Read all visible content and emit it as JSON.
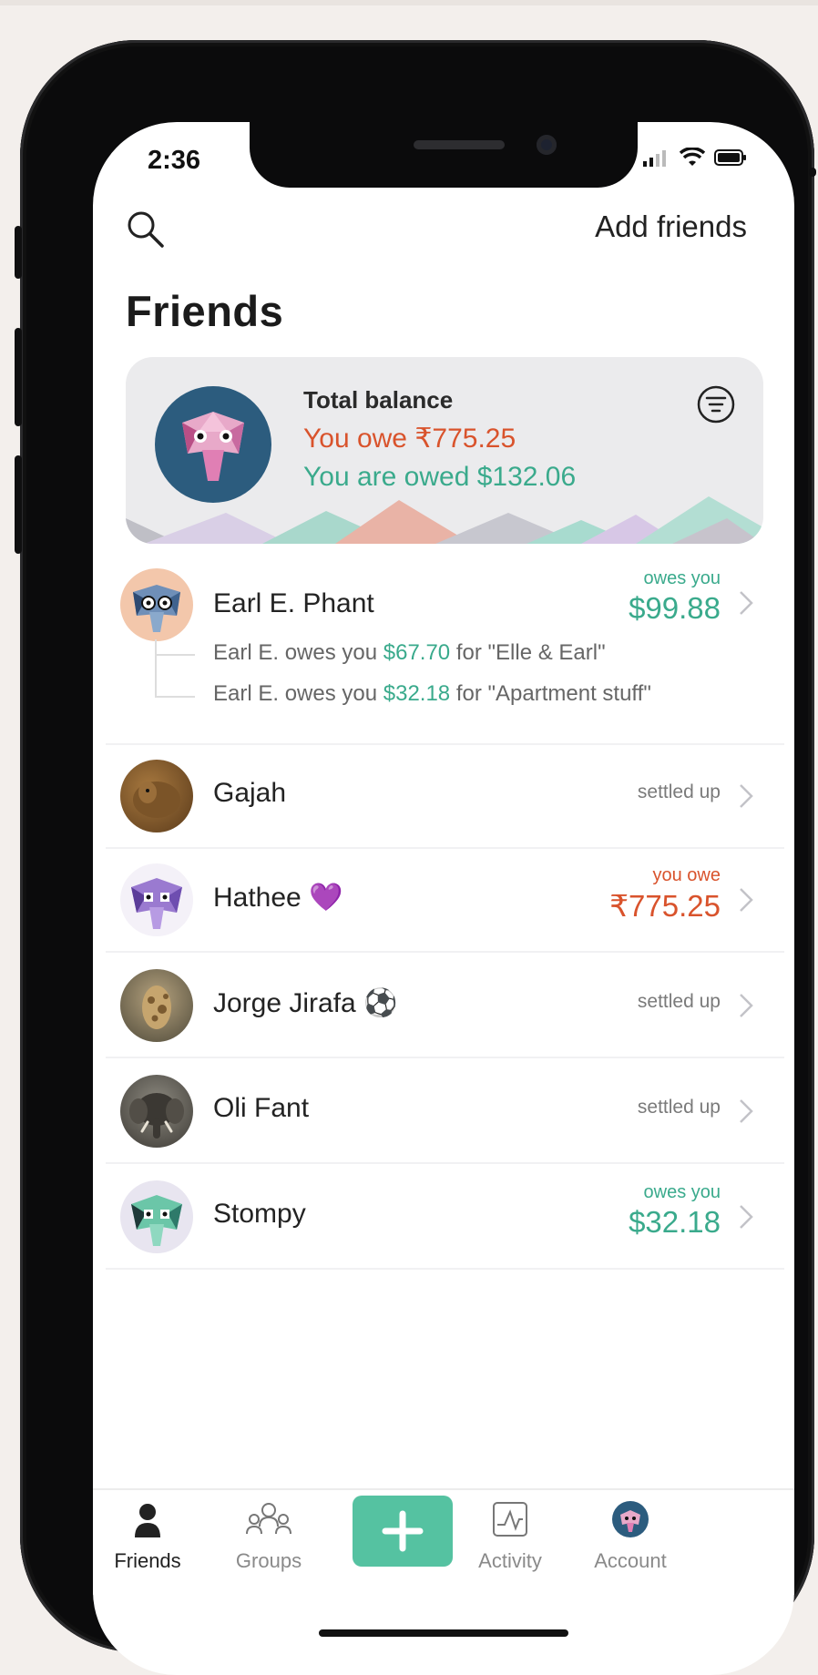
{
  "status_bar": {
    "time": "2:36"
  },
  "header": {
    "add_friends_label": "Add friends",
    "title": "Friends"
  },
  "balance": {
    "label": "Total balance",
    "you_owe": "You owe ₹775.25",
    "you_are_owed": "You are owed $132.06",
    "colors": {
      "owe": "#d9532c",
      "owed": "#3aaa8c"
    }
  },
  "friends": [
    {
      "name": "Earl E. Phant",
      "status_label": "owes you",
      "amount": "$99.88",
      "tone": "owed",
      "details": [
        {
          "prefix": "Earl E. owes you ",
          "amount": "$67.70",
          "suffix": " for \"Elle & Earl\""
        },
        {
          "prefix": "Earl E. owes you ",
          "amount": "$32.18",
          "suffix": " for \"Apartment stuff\""
        }
      ]
    },
    {
      "name": "Gajah",
      "status_label": "settled up"
    },
    {
      "name": "Hathee 💜",
      "status_label": "you owe",
      "amount": "₹775.25",
      "tone": "owe"
    },
    {
      "name": "Jorge Jirafa ⚽",
      "status_label": "settled up"
    },
    {
      "name": "Oli Fant",
      "status_label": "settled up"
    },
    {
      "name": "Stompy",
      "status_label": "owes you",
      "amount": "$32.18",
      "tone": "owed"
    }
  ],
  "tabbar": {
    "friends": "Friends",
    "groups": "Groups",
    "activity": "Activity",
    "account": "Account"
  }
}
